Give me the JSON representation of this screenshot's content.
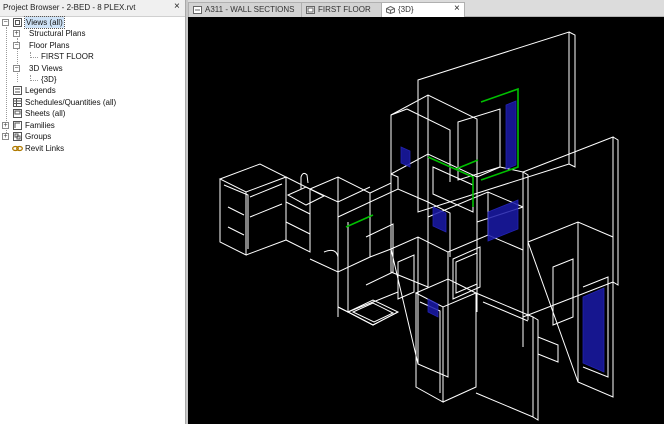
{
  "project_browser": {
    "title": "Project Browser - 2-BED - 8 PLEX.rvt",
    "close_glyph": "×",
    "tree": [
      {
        "label": "Views (all)",
        "icon": "views-icon",
        "expander": "−",
        "selected": true
      },
      {
        "label": "Structural Plans",
        "expander": "+"
      },
      {
        "label": "Floor Plans",
        "expander": "−"
      },
      {
        "label": "FIRST FLOOR"
      },
      {
        "label": "3D Views",
        "expander": "−"
      },
      {
        "label": "{3D}"
      },
      {
        "label": "Legends",
        "icon": "legend-icon"
      },
      {
        "label": "Schedules/Quantities (all)",
        "icon": "schedule-icon"
      },
      {
        "label": "Sheets (all)",
        "icon": "sheet-icon"
      },
      {
        "label": "Families",
        "icon": "family-icon",
        "expander": "+"
      },
      {
        "label": "Groups",
        "icon": "group-icon",
        "expander": "+"
      },
      {
        "label": "Revit Links",
        "icon": "link-icon"
      }
    ]
  },
  "tabs": [
    {
      "label": "A311 - WALL SECTIONS",
      "icon": "section-view-icon",
      "active": false
    },
    {
      "label": "FIRST FLOOR",
      "icon": "floor-plan-icon",
      "active": false
    },
    {
      "label": "{3D}",
      "icon": "3d-view-icon",
      "active": true,
      "close_glyph": "×"
    }
  ],
  "colors": {
    "viewport_bg": "#000000",
    "model_line": "#ffffff",
    "window_frame": "#00c000",
    "glass": "#1a1aa8"
  }
}
